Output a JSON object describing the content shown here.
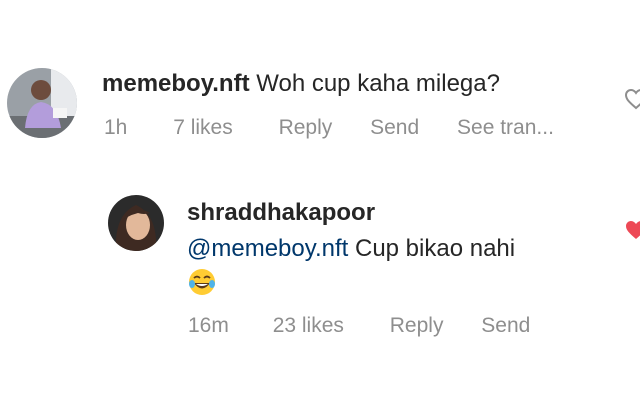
{
  "comment": {
    "username": "memeboy.nft",
    "text": "Woh cup kaha milega?",
    "time": "1h",
    "likes": "7 likes",
    "reply_label": "Reply",
    "send_label": "Send",
    "translate_label": "See tran..."
  },
  "reply": {
    "username": "shraddhakapoor",
    "mention": "@memeboy.nft",
    "text": "Cup bikao nahi",
    "emoji": "face-with-tears-of-joy",
    "time": "16m",
    "likes": "23 likes",
    "reply_label": "Reply",
    "send_label": "Send",
    "liked": true
  },
  "colors": {
    "username": "#262626",
    "mention": "#00376b",
    "meta": "#8e8e8e",
    "like_active": "#ed4956"
  }
}
